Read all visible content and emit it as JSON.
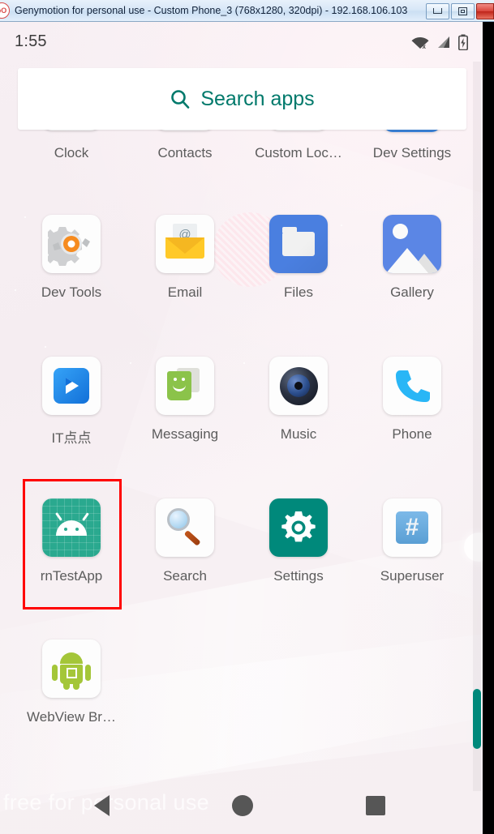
{
  "window": {
    "title": "Genymotion for personal use - Custom Phone_3 (768x1280, 320dpi) - 192.168.106.103",
    "icon": "genymotion-logo-icon",
    "buttons": {
      "minimize": "minimize-button",
      "maximize": "maximize-button",
      "close": "close-button"
    }
  },
  "statusbar": {
    "time": "1:55",
    "icons": [
      "wifi-off-icon",
      "cellular-signal-icon",
      "battery-charging-icon"
    ]
  },
  "search": {
    "label": "Search apps",
    "icon": "search-icon",
    "accent": "#00796B"
  },
  "app_grid": {
    "rows": [
      {
        "clipped": true,
        "apps": [
          {
            "label": "Clock",
            "icon": "clock-icon"
          },
          {
            "label": "Contacts",
            "icon": "contacts-icon"
          },
          {
            "label": "Custom Loc…",
            "icon": "custom-locale-icon"
          },
          {
            "label": "Dev Settings",
            "icon": "dev-settings-icon"
          }
        ]
      },
      {
        "clipped": false,
        "apps": [
          {
            "label": "Dev Tools",
            "icon": "dev-tools-gear-icon"
          },
          {
            "label": "Email",
            "icon": "email-envelope-icon"
          },
          {
            "label": "Files",
            "icon": "files-folder-icon"
          },
          {
            "label": "Gallery",
            "icon": "gallery-photo-icon"
          }
        ]
      },
      {
        "clipped": false,
        "apps": [
          {
            "label": "IT点点",
            "icon": "it-diandian-play-icon"
          },
          {
            "label": "Messaging",
            "icon": "messaging-chat-icon"
          },
          {
            "label": "Music",
            "icon": "music-speaker-icon"
          },
          {
            "label": "Phone",
            "icon": "phone-handset-icon"
          }
        ]
      },
      {
        "clipped": false,
        "apps": [
          {
            "label": "rnTestApp",
            "icon": "rntestapp-android-icon",
            "selected": true
          },
          {
            "label": "Search",
            "icon": "search-magnifier-icon"
          },
          {
            "label": "Settings",
            "icon": "settings-gear-icon"
          },
          {
            "label": "Superuser",
            "icon": "superuser-hash-icon"
          }
        ]
      },
      {
        "clipped": false,
        "apps": [
          {
            "label": "WebView Br…",
            "icon": "webview-browser-android-icon"
          }
        ]
      }
    ],
    "selection_color": "#ff0000"
  },
  "scrollbar": {
    "thumb_color": "#00897B"
  },
  "watermark": {
    "text": "free for personal use"
  },
  "navbar": {
    "back": "back-triangle-icon",
    "home": "home-circle-icon",
    "recents": "recents-square-icon"
  }
}
